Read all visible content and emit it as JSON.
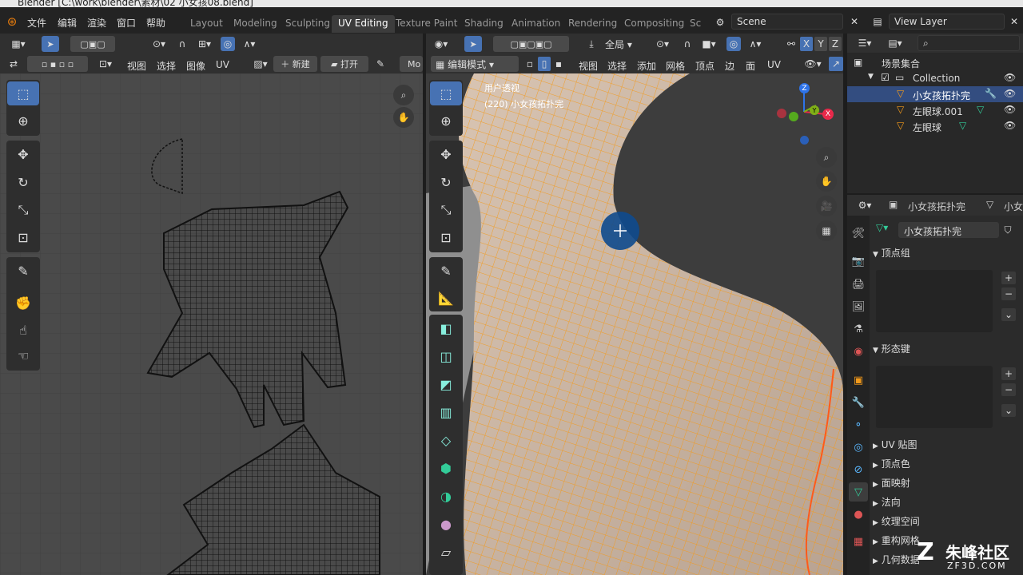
{
  "window": {
    "title": "Blender [C:\\work\\blender\\素材\\02 小女孩08.blend]"
  },
  "menu": [
    "文件",
    "编辑",
    "渲染",
    "窗口",
    "帮助"
  ],
  "workspaces": [
    "Layout",
    "Modeling",
    "Sculpting",
    "UV Editing",
    "Texture Paint",
    "Shading",
    "Animation",
    "Rendering",
    "Compositing",
    "Sc"
  ],
  "active_workspace": "UV Editing",
  "scene": {
    "name": "Scene"
  },
  "view_layer": {
    "name": "View Layer"
  },
  "uv_editor": {
    "menus": [
      "视图",
      "选择",
      "图像",
      "UV"
    ],
    "new_label": "新建",
    "open_label": "打开",
    "mode_label": "Mo"
  },
  "viewport": {
    "mode": "编辑模式",
    "transform_orientation": "全局",
    "menus": [
      "视图",
      "选择",
      "添加",
      "网格",
      "顶点",
      "边",
      "面",
      "UV"
    ],
    "overlay_text": "用户透视",
    "object_info": "(220) 小女孩拓扑完",
    "axes": {
      "x": "X",
      "y": "Y",
      "z": "Z"
    },
    "colors": {
      "wire": "#f39a1a",
      "skin": "#cdb8a6"
    }
  },
  "outliner": {
    "root": "场景集合",
    "collection": "Collection",
    "objects": [
      "小女孩拓扑完",
      "左眼球.001",
      "左眼球"
    ]
  },
  "properties": {
    "header_object": "小女孩拓扑完",
    "header_truncated": "小女",
    "mesh_name": "小女孩拓扑完",
    "panels_open": [
      "顶点组",
      "形态键"
    ],
    "panels_closed": [
      "UV 贴图",
      "顶点色",
      "面映射",
      "法向",
      "纹理空间",
      "重构网格",
      "几何数据"
    ]
  },
  "watermark": {
    "brand": "朱峰社区",
    "site": "ZF3D.COM"
  },
  "colors": {
    "accent": "#4772b3",
    "bg": "#1d1d1d",
    "panel": "#303030",
    "uv_bg": "#4a4a4a"
  }
}
